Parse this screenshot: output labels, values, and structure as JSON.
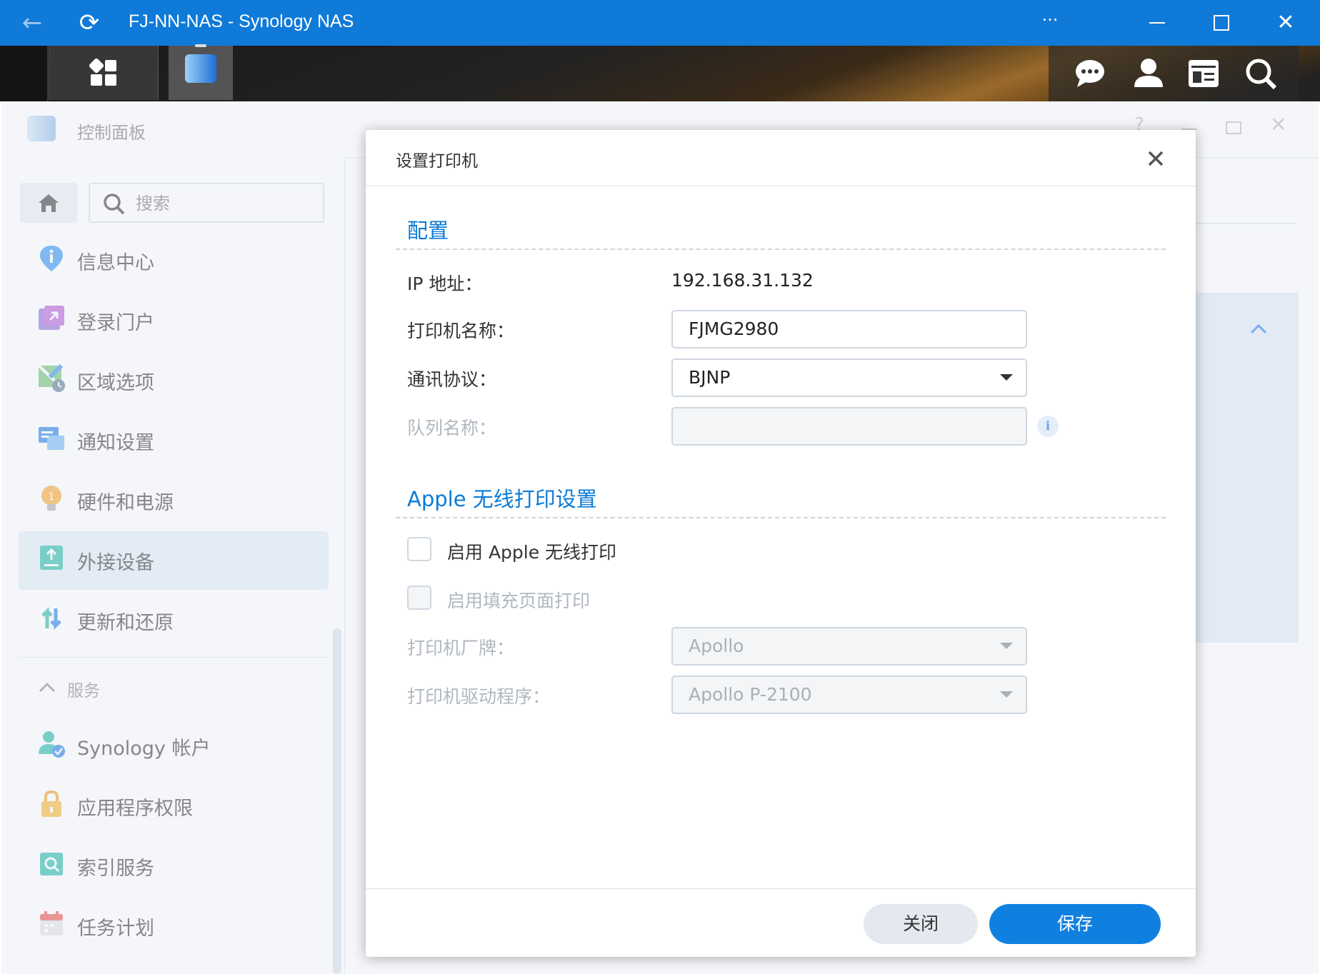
{
  "browser": {
    "title": "FJ-NN-NAS - Synology NAS",
    "more_label": "···",
    "icons": [
      "back-arrow-icon",
      "refresh-icon",
      "more-icon",
      "minimize-icon",
      "maximize-icon",
      "close-icon"
    ]
  },
  "control_panel": {
    "title": "控制面板",
    "search_placeholder": "搜索",
    "sidebar": {
      "items": [
        {
          "label": "信息中心",
          "icon": "info-center-icon"
        },
        {
          "label": "登录门户",
          "icon": "login-portal-icon"
        },
        {
          "label": "区域选项",
          "icon": "regional-options-icon"
        },
        {
          "label": "通知设置",
          "icon": "notification-icon"
        },
        {
          "label": "硬件和电源",
          "icon": "hardware-power-icon"
        },
        {
          "label": "外接设备",
          "icon": "external-devices-icon",
          "active": true
        },
        {
          "label": "更新和还原",
          "icon": "update-restore-icon"
        }
      ],
      "section_label": "服务",
      "service_items": [
        {
          "label": "Synology 帐户",
          "icon": "synology-account-icon"
        },
        {
          "label": "应用程序权限",
          "icon": "application-privileges-icon"
        },
        {
          "label": "索引服务",
          "icon": "indexing-service-icon"
        },
        {
          "label": "任务计划",
          "icon": "task-scheduler-icon"
        }
      ]
    }
  },
  "dialog": {
    "title": "设置打印机",
    "config_section": "配置",
    "ip_label": "IP 地址：",
    "ip_value": "192.168.31.132",
    "printer_name_label": "打印机名称：",
    "printer_name_value": "FJMG2980",
    "protocol_label": "通讯协议：",
    "protocol_value": "BJNP",
    "queue_label": "队列名称：",
    "queue_value": "",
    "apple_section": "Apple 无线打印设置",
    "enable_airprint_label": "启用 Apple 无线打印",
    "enable_fill_label": "启用填充页面打印",
    "brand_label": "打印机厂牌：",
    "brand_value": "Apollo",
    "driver_label": "打印机驱动程序：",
    "driver_value": "Apollo P-2100",
    "close_label": "关闭",
    "save_label": "保存"
  },
  "colors": {
    "titlebar": "#0f7ad8",
    "accent": "#0b7bd6",
    "save_button": "#1080e0",
    "close_button": "#e4e9ef"
  }
}
